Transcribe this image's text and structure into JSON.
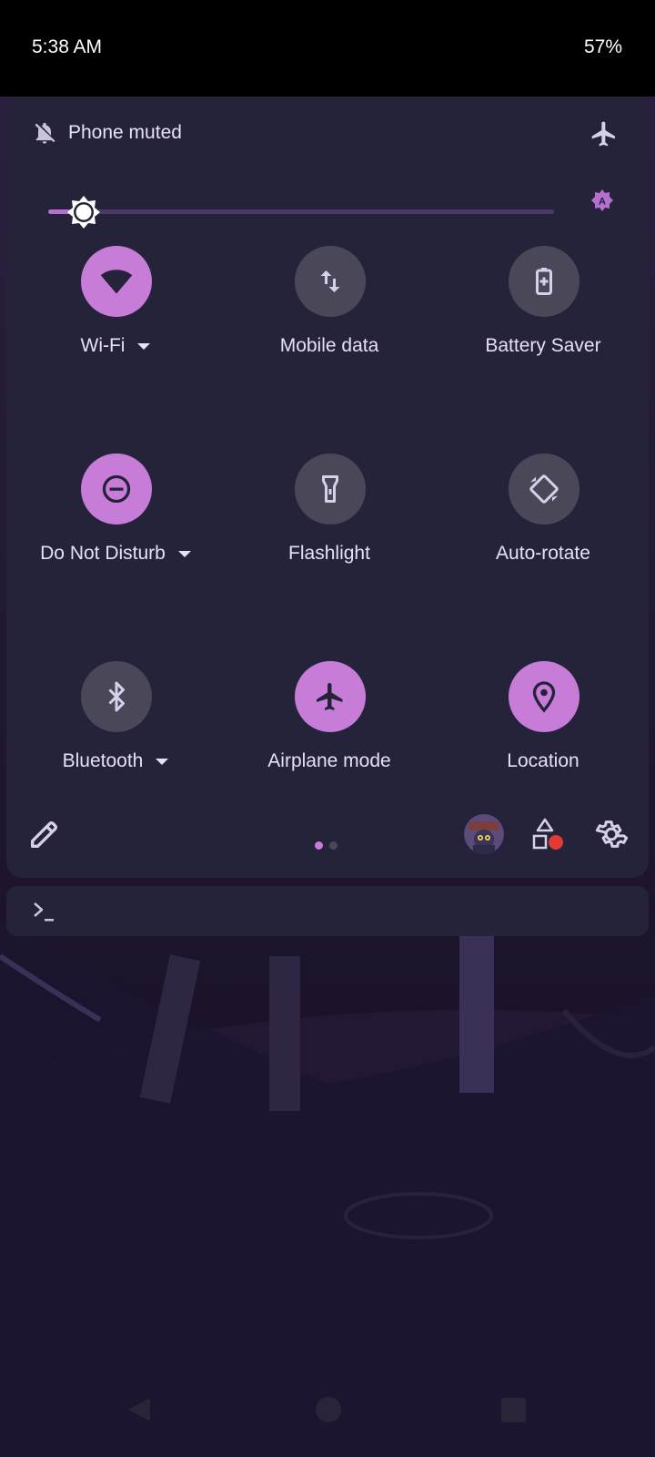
{
  "status_bar": {
    "time": "5:38 AM",
    "battery": "57%"
  },
  "header": {
    "ringer_label": "Phone muted",
    "ringer_icon": "bell-off-icon",
    "airplane_icon": "airplane-icon"
  },
  "brightness": {
    "level": 0.07,
    "auto_icon": "auto-brightness-icon"
  },
  "tiles": [
    {
      "label": "Wi-Fi",
      "icon": "wifi-icon",
      "active": true,
      "has_dropdown": true
    },
    {
      "label": "Mobile data",
      "icon": "mobile-data-icon",
      "active": false,
      "has_dropdown": false
    },
    {
      "label": "Battery Saver",
      "icon": "battery-saver-icon",
      "active": false,
      "has_dropdown": false
    },
    {
      "label": "Do Not Disturb",
      "icon": "do-not-disturb-icon",
      "active": true,
      "has_dropdown": true
    },
    {
      "label": "Flashlight",
      "icon": "flashlight-icon",
      "active": false,
      "has_dropdown": false
    },
    {
      "label": "Auto-rotate",
      "icon": "auto-rotate-icon",
      "active": false,
      "has_dropdown": false
    },
    {
      "label": "Bluetooth",
      "icon": "bluetooth-icon",
      "active": false,
      "has_dropdown": true
    },
    {
      "label": "Airplane mode",
      "icon": "airplane-icon",
      "active": true,
      "has_dropdown": false
    },
    {
      "label": "Location",
      "icon": "location-icon",
      "active": true,
      "has_dropdown": false
    }
  ],
  "footer": {
    "page_index": 1,
    "page_count": 2
  },
  "colors": {
    "panel": "#24233a",
    "accent": "#c77dd8",
    "inactive": "#4a4858",
    "notification_dot": "#e53935"
  }
}
